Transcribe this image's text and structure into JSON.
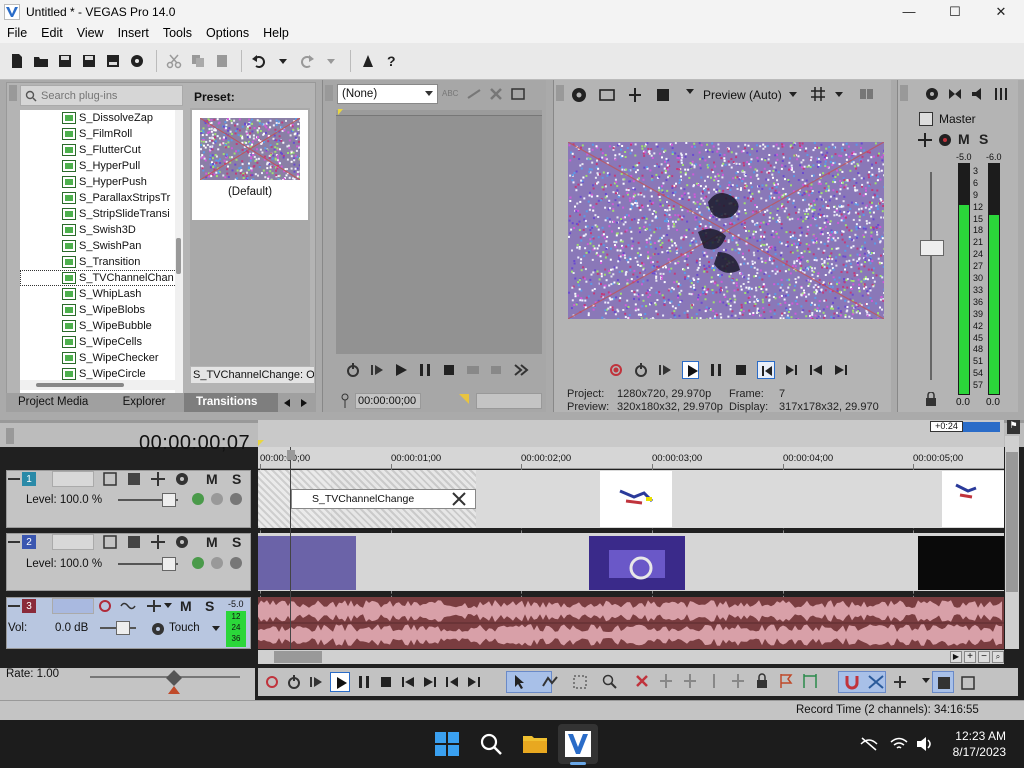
{
  "window": {
    "title": "Untitled * - VEGAS Pro 14.0",
    "controls": {
      "minimize": "—",
      "maximize": "☐",
      "close": "✕"
    }
  },
  "menu": [
    "File",
    "Edit",
    "View",
    "Insert",
    "Tools",
    "Options",
    "Help"
  ],
  "plugins": {
    "search_placeholder": "Search plug-ins",
    "items": [
      "S_DissolveZap",
      "S_FilmRoll",
      "S_FlutterCut",
      "S_HyperPull",
      "S_HyperPush",
      "S_ParallaxStripsTr",
      "S_StripSlideTransi",
      "S_Swish3D",
      "S_SwishPan",
      "S_Transition",
      "S_TVChannelChan",
      "S_WhipLash",
      "S_WipeBlobs",
      "S_WipeBubble",
      "S_WipeCells",
      "S_WipeChecker",
      "S_WipeCircle"
    ],
    "selected_index": 10,
    "preset_label": "Preset:",
    "preset_name": "(Default)",
    "status": "S_TVChannelChange: Of"
  },
  "tabs": [
    "Project Media",
    "Explorer",
    "Transitions"
  ],
  "active_tab": 2,
  "trimmer": {
    "select_value": "(None)",
    "timecode": "00:00:00;00"
  },
  "preview": {
    "mode": "Preview (Auto)",
    "project_label": "Project:",
    "project_value": "1280x720, 29.970p",
    "preview_label": "Preview:",
    "preview_value": "320x180x32, 29.970p",
    "frame_label": "Frame:",
    "frame_value": "7",
    "display_label": "Display:",
    "display_value": "317x178x32, 29.970"
  },
  "master": {
    "label": "Master",
    "m": "M",
    "s": "S",
    "peak_left": "-5.0",
    "peak_right": "-6.0",
    "scale": [
      "3",
      "6",
      "9",
      "12",
      "15",
      "18",
      "21",
      "24",
      "27",
      "30",
      "33",
      "36",
      "39",
      "42",
      "45",
      "48",
      "51",
      "54",
      "57"
    ],
    "fader_left": "0.0",
    "fader_right": "0.0",
    "level_left": 0.82,
    "level_right": 0.78
  },
  "timeline": {
    "timecode": "00:00:00;07",
    "zoom_badge": "+0:24",
    "ruler": [
      "00:00:00;00",
      "00:00:01;00",
      "00:00:02;00",
      "00:00:03;00",
      "00:00:04;00",
      "00:00:05;00"
    ],
    "transition_label": "S_TVChannelChange"
  },
  "tracks": [
    {
      "num": "1",
      "level": "Level: 100.0 %",
      "m": "M",
      "s": "S"
    },
    {
      "num": "2",
      "level": "Level: 100.0 %",
      "m": "M",
      "s": "S"
    },
    {
      "num": "3",
      "vol": "Vol:",
      "vol_value": "0.0 dB",
      "touch": "Touch",
      "m": "M",
      "s": "S",
      "peak": "-5.0",
      "meter_a": "12",
      "meter_b": "24",
      "meter_c": "36"
    }
  ],
  "rate": "Rate: 1.00",
  "record_time": "Record Time (2 channels): 34:16:55",
  "clock": {
    "time": "12:23 AM",
    "date": "8/17/2023"
  },
  "colors": {
    "video_lane": "#7a3d40",
    "accent": "#2a6cc8",
    "meter_green": "#2bd63a"
  }
}
